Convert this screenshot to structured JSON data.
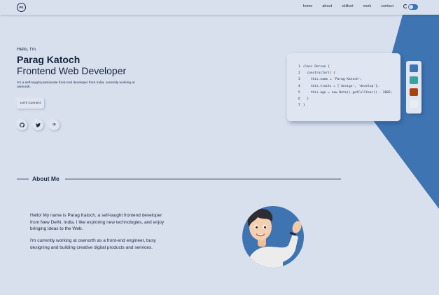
{
  "nav": {
    "logo": "PK",
    "links": [
      "home",
      "about",
      "skillset",
      "work",
      "contact"
    ]
  },
  "hero": {
    "greeting": "Hello, I'm",
    "name": "Parag Katoch",
    "role": "Frontend Web Developer",
    "description": "I'm a self-taught passionate front-end developer from India, currently working at osenorth.",
    "cta": "Let's Connect"
  },
  "code": {
    "lines": [
      {
        "n": "1",
        "text": "class Person {"
      },
      {
        "n": "2",
        "text": "  constructor() {"
      },
      {
        "n": "3",
        "text": "    this.name = 'Parag Katoch';"
      },
      {
        "n": "4",
        "text": "    this.traits = ['design', 'develop'];"
      },
      {
        "n": "5",
        "text": "    this.age = new Date().getFullYear() - 2002;"
      },
      {
        "n": "6",
        "text": "  }"
      },
      {
        "n": "7",
        "text": "}"
      }
    ]
  },
  "swatches": [
    "#3e74b2",
    "#3aa3a0",
    "#a8430f",
    "#e8ecf3"
  ],
  "colors": {
    "accent": "#3e74b2",
    "background": "#d8e0ee"
  },
  "about": {
    "title": "About Me",
    "p1": "Hello! My name is Parag Katoch, a self-taught frontend developer from New Delhi, India. I like exploring new technologies, and enjoy bringing ideas to the Web.",
    "p2": "I'm currently working at osenorth as a front-end engineer, busy designing and building creative digital products and services."
  }
}
